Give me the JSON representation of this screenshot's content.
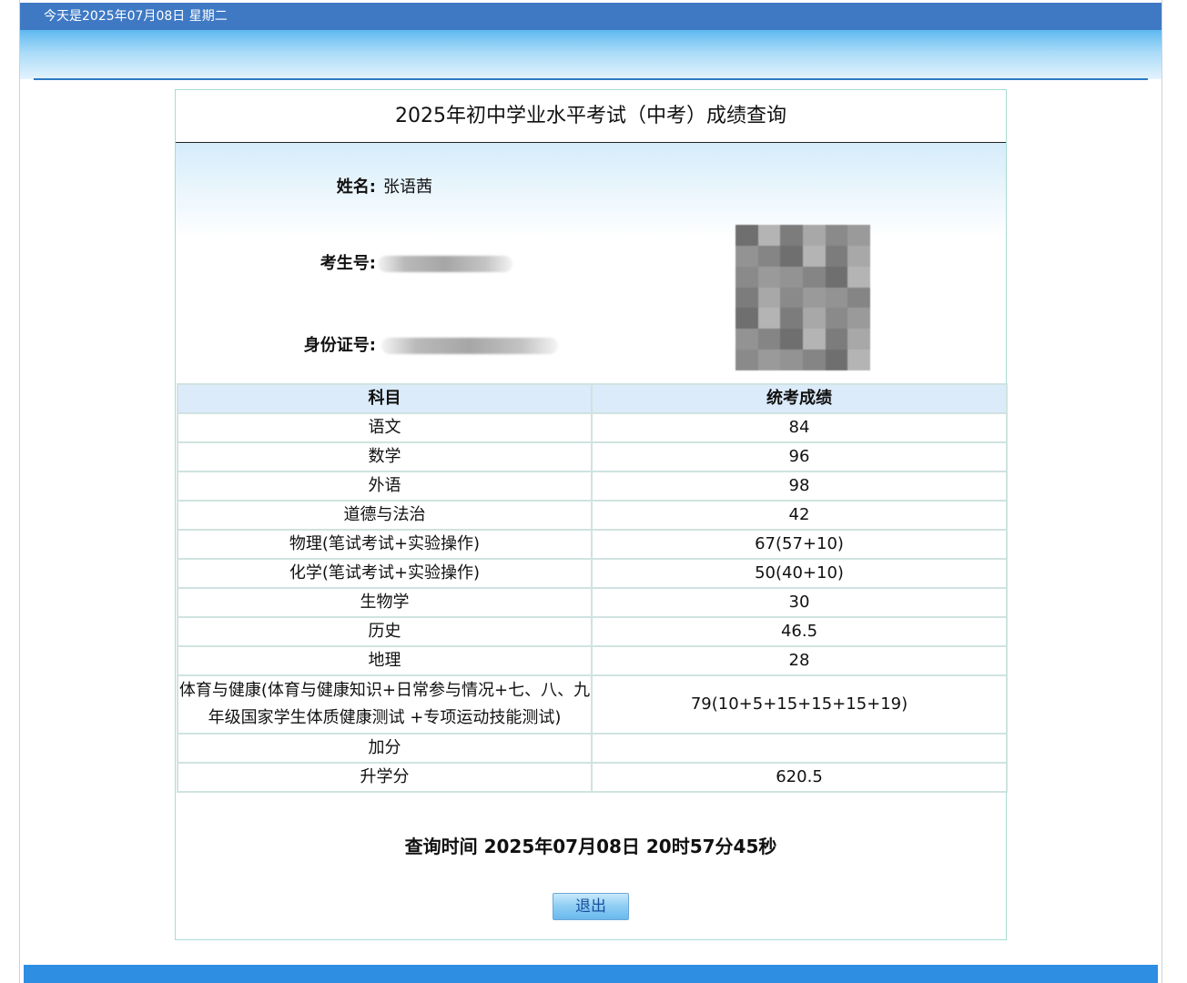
{
  "top_bar": {
    "date_text": "今天是2025年07月08日  星期二"
  },
  "page": {
    "title": "2025年初中学业水平考试（中考）成绩查询"
  },
  "student": {
    "name_label": "姓名:",
    "name_value": "张语茜",
    "exam_no_label": "考生号:",
    "id_no_label": "身份证号:"
  },
  "table": {
    "headers": [
      "科目",
      "统考成绩"
    ],
    "rows": [
      {
        "subject": "语文",
        "score": "84"
      },
      {
        "subject": "数学",
        "score": "96"
      },
      {
        "subject": "外语",
        "score": "98"
      },
      {
        "subject": "道德与法治",
        "score": "42"
      },
      {
        "subject": "物理(笔试考试+实验操作)",
        "score": "67(57+10)"
      },
      {
        "subject": "化学(笔试考试+实验操作)",
        "score": "50(40+10)"
      },
      {
        "subject": "生物学",
        "score": "30"
      },
      {
        "subject": "历史",
        "score": "46.5"
      },
      {
        "subject": "地理",
        "score": "28"
      },
      {
        "subject": "体育与健康(体育与健康知识+日常参与情况+七、八、九年级国家学生体质健康测试 +专项运动技能测试)",
        "score": "79(10+5+15+15+15+19)"
      },
      {
        "subject": "加分",
        "score": ""
      },
      {
        "subject": "升学分",
        "score": "620.5"
      }
    ]
  },
  "query_time": "查询时间  2025年07月08日 20时57分45秒",
  "buttons": {
    "exit_label": "退出"
  },
  "colors": {
    "top_bar": "#3f79c4",
    "header_line": "#2c79c4",
    "table_header_bg": "#dcebfa",
    "table_border": "#cfe3e0",
    "footer_bar": "#2d8ee2"
  }
}
